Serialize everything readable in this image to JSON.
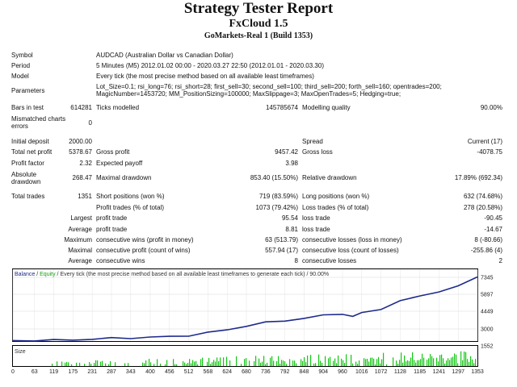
{
  "header": {
    "title": "Strategy Tester Report",
    "subtitle": "FxCloud 1.5",
    "server": "GoMarkets-Real 1 (Build 1353)"
  },
  "info": {
    "symbol_label": "Symbol",
    "symbol_value": "AUDCAD (Australian Dollar vs Canadian Dollar)",
    "period_label": "Period",
    "period_value": "5 Minutes (M5) 2012.01.02 00:00 - 2020.03.27 22:50 (2012.01.01 - 2020.03.30)",
    "model_label": "Model",
    "model_value": "Every tick (the most precise method based on all available least timeframes)",
    "parameters_label": "Parameters",
    "parameters_line1": "Lot_Size=0.1; rsi_long=76; rsi_short=28; first_sell=30; second_sell=100; third_sell=200; forth_sell=160; opentrades=200;",
    "parameters_line2": "MagicNumber=1453720; MM_PositionSizing=100000; MaxSlippage=3; MaxOpenTrades=5; Hedging=true;"
  },
  "ticks": {
    "bars_label": "Bars in test",
    "bars_value": "614281",
    "ticks_label": "Ticks modelled",
    "ticks_value": "145785674",
    "quality_label": "Modelling quality",
    "quality_value": "90.00%",
    "mismatch_label_1": "Mismatched charts",
    "mismatch_label_2": "errors",
    "mismatch_value": "0"
  },
  "results": {
    "initial_deposit_label": "Initial deposit",
    "initial_deposit_value": "2000.00",
    "spread_label": "Spread",
    "spread_value": "Current (17)",
    "net_profit_label": "Total net profit",
    "net_profit_value": "5378.67",
    "gross_profit_label": "Gross profit",
    "gross_profit_value": "9457.42",
    "gross_loss_label": "Gross loss",
    "gross_loss_value": "-4078.75",
    "profit_factor_label": "Profit factor",
    "profit_factor_value": "2.32",
    "expected_payoff_label": "Expected payoff",
    "expected_payoff_value": "3.98",
    "abs_dd_label_1": "Absolute",
    "abs_dd_label_2": "drawdown",
    "abs_dd_value": "268.47",
    "max_dd_label": "Maximal drawdown",
    "max_dd_value": "853.40 (15.50%)",
    "rel_dd_label": "Relative drawdown",
    "rel_dd_value": "17.89% (692.34)",
    "total_trades_label": "Total trades",
    "total_trades_value": "1351",
    "short_label": "Short positions (won %)",
    "short_value": "719 (83.59%)",
    "long_label": "Long positions (won %)",
    "long_value": "632 (74.68%)",
    "profit_trades_label": "Profit trades (% of total)",
    "profit_trades_value": "1073 (79.42%)",
    "loss_trades_label": "Loss trades (% of total)",
    "loss_trades_value": "278 (20.58%)",
    "largest_label": "Largest",
    "largest_profit_label": "profit trade",
    "largest_profit_value": "95.54",
    "largest_loss_label": "loss trade",
    "largest_loss_value": "-90.45",
    "average_label": "Average",
    "average_profit_label": "profit trade",
    "average_profit_value": "8.81",
    "average_loss_label": "loss trade",
    "average_loss_value": "-14.67",
    "maximum_label": "Maximum",
    "max_cons_wins_label": "consecutive wins (profit in money)",
    "max_cons_wins_value": "63 (513.79)",
    "max_cons_losses_label": "consecutive losses (loss in money)",
    "max_cons_losses_value": "8 (-80.66)",
    "maximal_label": "Maximal",
    "maximal_profit_label": "consecutive profit (count of wins)",
    "maximal_profit_value": "557.94 (17)",
    "maximal_loss_label": "consecutive loss (count of losses)",
    "maximal_loss_value": "-255.86 (4)",
    "average2_label": "Average",
    "avg_cons_wins_label": "consecutive wins",
    "avg_cons_wins_value": "8",
    "avg_cons_losses_label": "consecutive losses",
    "avg_cons_losses_value": "2"
  },
  "chart_data": {
    "type": "line",
    "legend_balance": "Balance",
    "legend_separator": " / ",
    "legend_equity": "Equity",
    "legend_text": " / Every tick (the most precise method based on all available least timeframes to generate each tick) / 90.00%",
    "y_ticks": [
      "7345",
      "5897",
      "4449",
      "3000",
      "1552"
    ],
    "size_label": "Size",
    "x_ticks": [
      "0",
      "63",
      "119",
      "175",
      "231",
      "287",
      "343",
      "400",
      "456",
      "512",
      "568",
      "624",
      "680",
      "736",
      "792",
      "848",
      "904",
      "960",
      "1016",
      "1072",
      "1128",
      "1185",
      "1241",
      "1297",
      "1353"
    ],
    "balance_color": "#1e2a8c",
    "volume_color": "#13c613",
    "series": [
      {
        "name": "Balance",
        "x": [
          0,
          63,
          119,
          175,
          231,
          287,
          343,
          400,
          456,
          512,
          568,
          624,
          680,
          736,
          792,
          848,
          904,
          960,
          990,
          1016,
          1072,
          1128,
          1185,
          1241,
          1297,
          1353
        ],
        "values": [
          2000,
          2030,
          2010,
          2080,
          2120,
          2180,
          2240,
          2270,
          2330,
          2450,
          2650,
          2920,
          3250,
          3500,
          3700,
          3880,
          4110,
          4300,
          4000,
          4350,
          4700,
          5300,
          5800,
          6150,
          6550,
          7378.67
        ]
      }
    ]
  }
}
